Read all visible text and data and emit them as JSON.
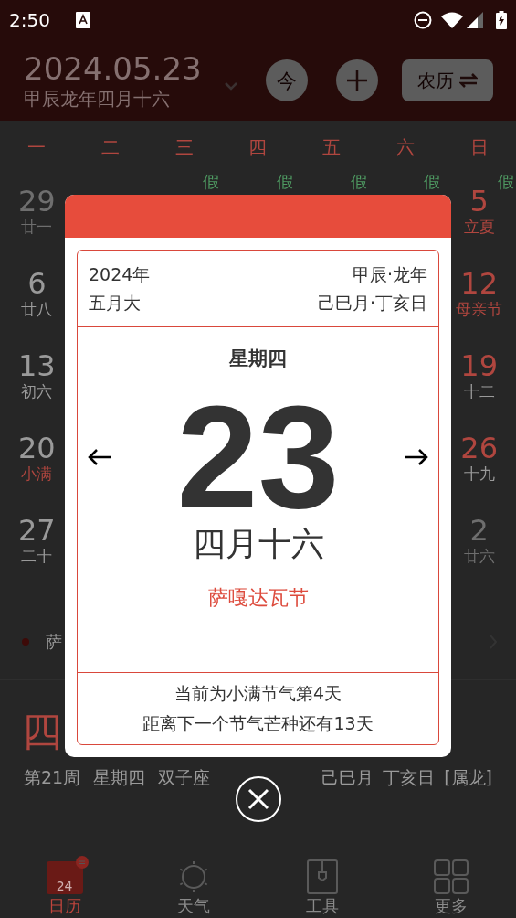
{
  "status_bar": {
    "time": "2:50"
  },
  "header": {
    "date": "2024.05.23",
    "lunar": "甲辰龙年四月十六",
    "today_button": "今",
    "mode_button": "农历"
  },
  "weekdays": [
    "一",
    "二",
    "三",
    "四",
    "五",
    "六",
    "日"
  ],
  "weeks": [
    {
      "cells": [
        {
          "kind": "other_month",
          "day": "29",
          "lunar": "廿一"
        },
        {
          "kind": "hidden"
        },
        {
          "kind": "hidden",
          "mark": "假"
        },
        {
          "kind": "hidden",
          "mark": "假"
        },
        {
          "kind": "hidden",
          "mark": "假"
        },
        {
          "kind": "hidden",
          "mark": "假"
        },
        {
          "kind": "weekend",
          "day": "5",
          "lunar": "立夏",
          "lunar_highlight": true,
          "mark": "假"
        }
      ]
    },
    {
      "cells": [
        {
          "kind": "current",
          "day": "6",
          "lunar": "廿八",
          "lunar_highlight": false
        },
        {
          "kind": "hidden"
        },
        {
          "kind": "hidden"
        },
        {
          "kind": "hidden"
        },
        {
          "kind": "hidden"
        },
        {
          "kind": "hidden"
        },
        {
          "kind": "weekend",
          "day": "12",
          "lunar": "母亲节",
          "lunar_highlight": true
        }
      ]
    },
    {
      "cells": [
        {
          "kind": "current",
          "day": "13",
          "lunar": "初六",
          "lunar_highlight": false
        },
        {
          "kind": "hidden"
        },
        {
          "kind": "hidden"
        },
        {
          "kind": "hidden"
        },
        {
          "kind": "hidden"
        },
        {
          "kind": "hidden"
        },
        {
          "kind": "weekend",
          "day": "19",
          "lunar": "十二",
          "lunar_highlight": false
        }
      ]
    },
    {
      "cells": [
        {
          "kind": "current",
          "day": "20",
          "lunar": "小满",
          "lunar_highlight": true
        },
        {
          "kind": "hidden"
        },
        {
          "kind": "hidden"
        },
        {
          "kind": "hidden"
        },
        {
          "kind": "hidden"
        },
        {
          "kind": "hidden"
        },
        {
          "kind": "weekend",
          "day": "26",
          "lunar": "十九",
          "lunar_highlight": false
        }
      ]
    },
    {
      "cells": [
        {
          "kind": "current",
          "day": "27",
          "lunar": "二十",
          "lunar_highlight": false
        },
        {
          "kind": "hidden"
        },
        {
          "kind": "hidden"
        },
        {
          "kind": "hidden"
        },
        {
          "kind": "hidden"
        },
        {
          "kind": "hidden"
        },
        {
          "kind": "other_month",
          "day": "2",
          "lunar": "廿六"
        }
      ]
    }
  ],
  "event": {
    "text": "萨"
  },
  "summary": {
    "lunar_day": "四",
    "left": [
      "第21周",
      "星期四",
      "双子座"
    ],
    "right": [
      "己巳月",
      "丁亥日",
      "[属龙]"
    ]
  },
  "tabs": [
    {
      "kind": "calendar",
      "label": "日历",
      "icon_text": "24",
      "selected": true
    },
    {
      "kind": "weather",
      "label": "天气",
      "selected": false
    },
    {
      "kind": "tools",
      "label": "工具",
      "selected": false
    },
    {
      "kind": "more",
      "label": "更多",
      "selected": false
    }
  ],
  "dialog": {
    "year": "2024年",
    "ganzhi_year": "甲辰·龙年",
    "month": "五月大",
    "ganzhi": "己巳月·丁亥日",
    "weekday": "星期四",
    "day": "23",
    "lunar": "四月十六",
    "festival": "萨嘎达瓦节",
    "notes": [
      "当前为小满节气第4天",
      "距离下一个节气芒种还有13天"
    ]
  }
}
